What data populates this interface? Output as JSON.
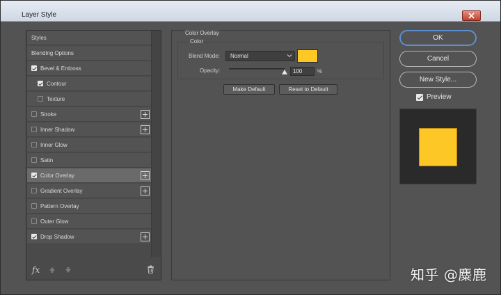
{
  "window": {
    "title": "Layer Style",
    "close_icon": "close-icon"
  },
  "styles_list": [
    {
      "label": "Styles",
      "has_checkbox": false,
      "checked": false,
      "indent": false,
      "has_add": false,
      "active": false
    },
    {
      "label": "Blending Options",
      "has_checkbox": false,
      "checked": false,
      "indent": false,
      "has_add": false,
      "active": false
    },
    {
      "label": "Bevel & Emboss",
      "has_checkbox": true,
      "checked": true,
      "indent": false,
      "has_add": false,
      "active": false
    },
    {
      "label": "Contour",
      "has_checkbox": true,
      "checked": true,
      "indent": true,
      "has_add": false,
      "active": false
    },
    {
      "label": "Texture",
      "has_checkbox": true,
      "checked": false,
      "indent": true,
      "has_add": false,
      "active": false
    },
    {
      "label": "Stroke",
      "has_checkbox": true,
      "checked": false,
      "indent": false,
      "has_add": true,
      "active": false
    },
    {
      "label": "Inner Shadow",
      "has_checkbox": true,
      "checked": false,
      "indent": false,
      "has_add": true,
      "active": false
    },
    {
      "label": "Inner Glow",
      "has_checkbox": true,
      "checked": false,
      "indent": false,
      "has_add": false,
      "active": false
    },
    {
      "label": "Satin",
      "has_checkbox": true,
      "checked": false,
      "indent": false,
      "has_add": false,
      "active": false
    },
    {
      "label": "Color Overlay",
      "has_checkbox": true,
      "checked": true,
      "indent": false,
      "has_add": true,
      "active": true
    },
    {
      "label": "Gradient Overlay",
      "has_checkbox": true,
      "checked": false,
      "indent": false,
      "has_add": true,
      "active": false
    },
    {
      "label": "Pattern Overlay",
      "has_checkbox": true,
      "checked": false,
      "indent": false,
      "has_add": false,
      "active": false
    },
    {
      "label": "Outer Glow",
      "has_checkbox": true,
      "checked": false,
      "indent": false,
      "has_add": false,
      "active": false
    },
    {
      "label": "Drop Shadow",
      "has_checkbox": true,
      "checked": true,
      "indent": false,
      "has_add": true,
      "active": false
    }
  ],
  "styles_footer": {
    "fx_label": "fx",
    "icons": [
      "fx-icon",
      "move-up-icon",
      "move-down-icon",
      "trash-icon"
    ]
  },
  "color_overlay": {
    "group_title": "Color Overlay",
    "subgroup_title": "Color",
    "blend_mode_label": "Blend Mode:",
    "blend_mode_value": "Normal",
    "swatch_color": "#fdc825",
    "opacity_label": "Opacity:",
    "opacity_value": "100",
    "opacity_level": 1.0,
    "percent_sign": "%",
    "make_default_label": "Make Default",
    "reset_default_label": "Reset to Default"
  },
  "actions": {
    "ok_label": "OK",
    "cancel_label": "Cancel",
    "new_style_label": "New Style...",
    "preview_label": "Preview",
    "preview_checked": true
  },
  "colors": {
    "accent": "#5d8ecf",
    "overlay": "#fdc825"
  },
  "watermark": "知乎 @麋鹿"
}
